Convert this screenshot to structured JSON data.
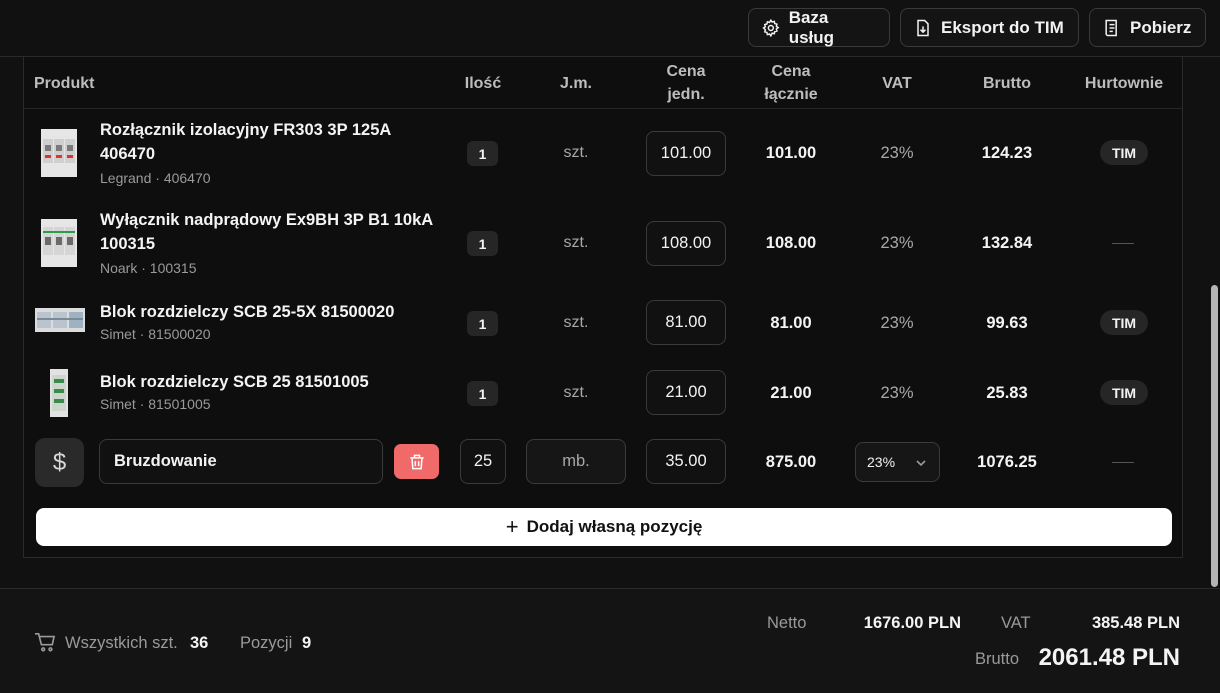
{
  "toolbar": {
    "services_label": "Baza usług",
    "export_label": "Eksport do TIM",
    "download_label": "Pobierz"
  },
  "table": {
    "headers": {
      "product": "Produkt",
      "qty": "Ilość",
      "unit": "J.m.",
      "unit_price_1": "Cena",
      "unit_price_2": "jedn.",
      "total_1": "Cena",
      "total_2": "łącznie",
      "vat": "VAT",
      "gross": "Brutto",
      "wholesalers": "Hurtownie"
    },
    "rows": [
      {
        "name_1": "Rozłącznik izolacyjny FR303 3P 125A",
        "name_2": "406470",
        "sub": "Legrand · 406470",
        "qty": "1",
        "unit": "szt.",
        "price": "101.00",
        "total": "101.00",
        "vat": "23%",
        "gross": "124.23",
        "wholesaler": "TIM"
      },
      {
        "name_1": "Wyłącznik nadprądowy Ex9BH 3P B1 10kA",
        "name_2": "100315",
        "sub": "Noark · 100315",
        "qty": "1",
        "unit": "szt.",
        "price": "108.00",
        "total": "108.00",
        "vat": "23%",
        "gross": "132.84",
        "wholesaler": ""
      },
      {
        "name_1": "Blok rozdzielczy SCB 25-5X 81500020",
        "sub": "Simet · 81500020",
        "qty": "1",
        "unit": "szt.",
        "price": "81.00",
        "total": "81.00",
        "vat": "23%",
        "gross": "99.63",
        "wholesaler": "TIM"
      },
      {
        "name_1": "Blok rozdzielczy SCB 25 81501005",
        "sub": "Simet · 81501005",
        "qty": "1",
        "unit": "szt.",
        "price": "21.00",
        "total": "21.00",
        "vat": "23%",
        "gross": "25.83",
        "wholesaler": "TIM"
      }
    ],
    "custom_row": {
      "icon": "dollar-icon",
      "name": "Bruzdowanie",
      "qty": "25",
      "unit": "mb.",
      "price": "35.00",
      "total": "875.00",
      "vat_selected": "23%",
      "gross": "1076.25"
    },
    "add_label": "Dodaj własną pozycję"
  },
  "footer": {
    "all_items_label": "Wszystkich szt.",
    "all_items_value": "36",
    "positions_label": "Pozycji",
    "positions_value": "9",
    "net_label": "Netto",
    "net_value": "1676.00 PLN",
    "vat_label": "VAT",
    "vat_value": "385.48 PLN",
    "gross_label": "Brutto",
    "gross_value": "2061.48 PLN"
  },
  "colors": {
    "background": "#111111",
    "delete_button": "#f06a6a",
    "add_button": "#ffffff",
    "badge": "#262626"
  }
}
